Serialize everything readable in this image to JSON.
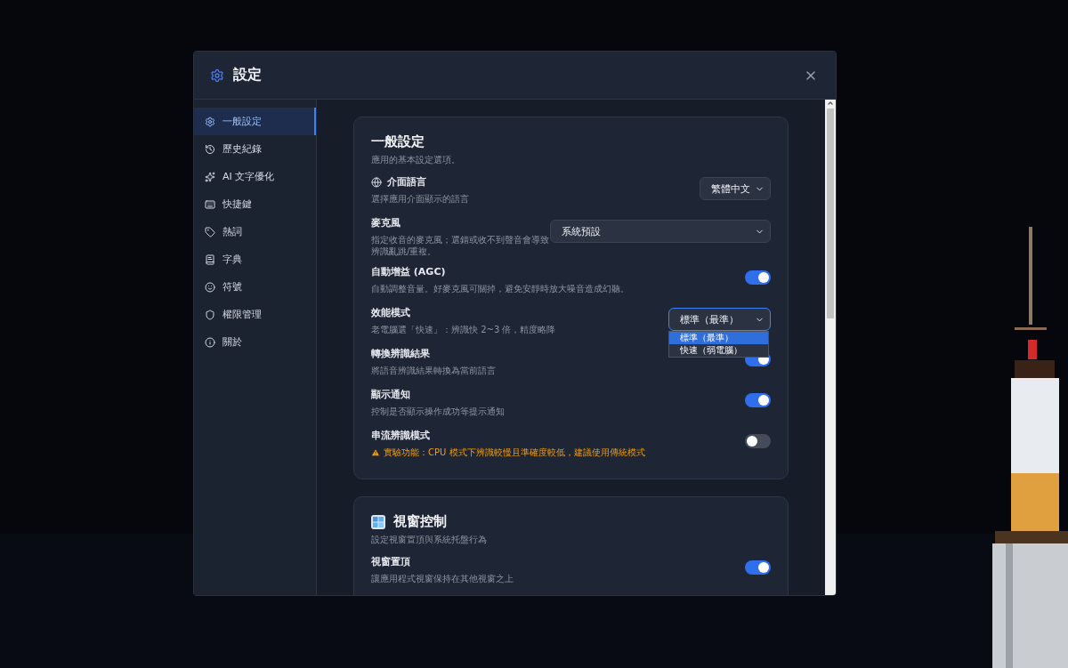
{
  "window": {
    "title": "設定"
  },
  "sidebar": {
    "items": [
      {
        "label": "一般設定",
        "selected": true
      },
      {
        "label": "歷史紀錄",
        "selected": false
      },
      {
        "label": "AI 文字優化",
        "selected": false
      },
      {
        "label": "快捷鍵",
        "selected": false
      },
      {
        "label": "熱詞",
        "selected": false
      },
      {
        "label": "字典",
        "selected": false
      },
      {
        "label": "符號",
        "selected": false
      },
      {
        "label": "權限管理",
        "selected": false
      },
      {
        "label": "關於",
        "selected": false
      }
    ]
  },
  "sections": [
    {
      "title": "一般設定",
      "subtitle": "應用的基本設定選項。",
      "settings": [
        {
          "kind": "select",
          "label": "介面語言",
          "description": "選擇應用介面顯示的語言",
          "value": "繁體中文",
          "expanded": false,
          "warning": false
        },
        {
          "kind": "select",
          "label": "麥克風",
          "description": "指定收音的麥克風；選錯或收不到聲音會導致辨識亂跳/重複。",
          "value": "系統預設",
          "expanded": false,
          "warning": false
        },
        {
          "kind": "toggle",
          "label": "自動增益 (AGC)",
          "description": "自動調整音量。好麥克風可關掉，避免安靜時放大噪音造成幻聽。",
          "on": true,
          "warning": false
        },
        {
          "kind": "select",
          "label": "效能模式",
          "description": "老電腦選「快速」：辨識快 2~3 倍，精度略降",
          "value": "標準（最準）",
          "expanded": true,
          "warning": false,
          "options": [
            {
              "label": "標準（最準）",
              "selected": true
            },
            {
              "label": "快速（弱電腦）",
              "selected": false
            }
          ]
        },
        {
          "kind": "toggle",
          "label": "轉換辨識結果",
          "description": "將語音辨識結果轉換為當前語言",
          "on": true,
          "warning": false
        },
        {
          "kind": "toggle",
          "label": "顯示通知",
          "description": "控制是否顯示操作成功等提示通知",
          "on": true,
          "warning": false
        },
        {
          "kind": "toggle",
          "label": "串流辨識模式",
          "description": "實驗功能：CPU 模式下辨識較慢且準確度較低，建議使用傳統模式",
          "on": false,
          "warning": true
        }
      ]
    },
    {
      "title": "視窗控制",
      "subtitle": "設定視窗置頂與系統托盤行為",
      "settings": [
        {
          "kind": "toggle",
          "label": "視窗置頂",
          "description": "讓應用程式視窗保持在其他視窗之上",
          "on": true,
          "warning": false
        }
      ]
    }
  ]
}
